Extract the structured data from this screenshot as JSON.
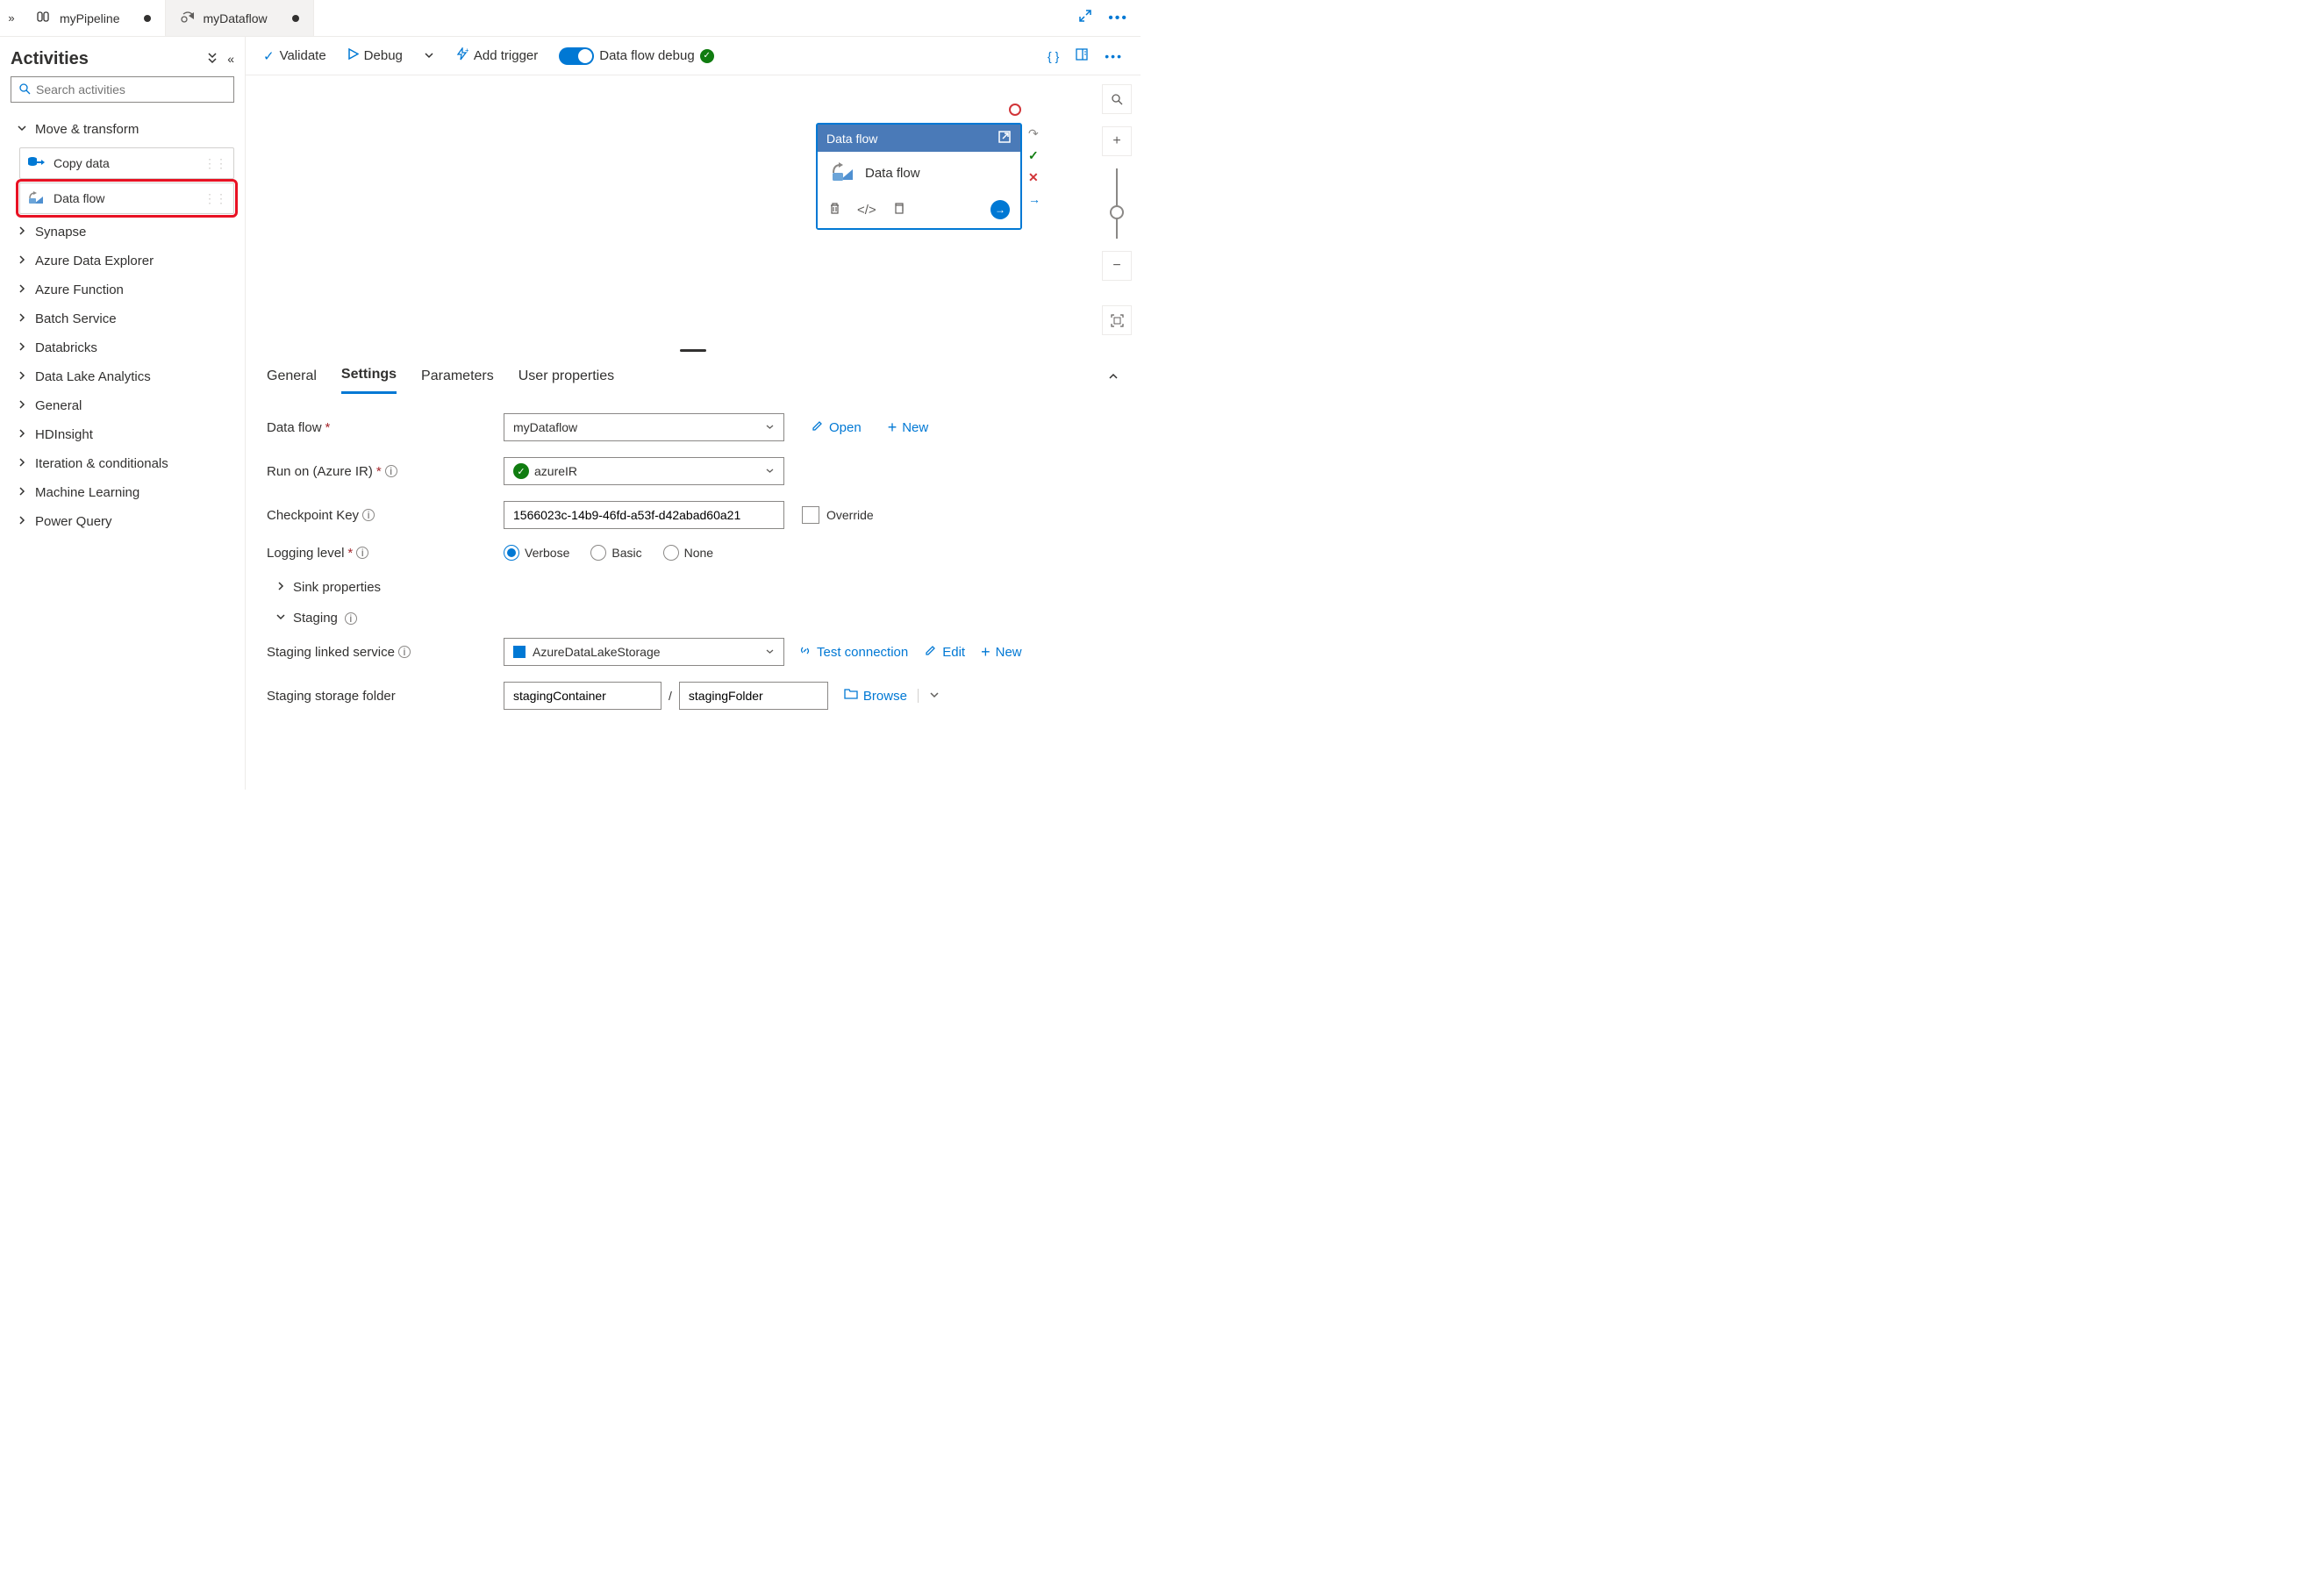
{
  "tabs": {
    "pipeline": "myPipeline",
    "dataflow": "myDataflow"
  },
  "sidebar": {
    "title": "Activities",
    "search_placeholder": "Search activities",
    "move_transform": "Move & transform",
    "copy_data": "Copy data",
    "data_flow": "Data flow",
    "categories": {
      "synapse": "Synapse",
      "ade": "Azure Data Explorer",
      "func": "Azure Function",
      "batch": "Batch Service",
      "databricks": "Databricks",
      "dla": "Data Lake Analytics",
      "general": "General",
      "hdinsight": "HDInsight",
      "iteration": "Iteration & conditionals",
      "ml": "Machine Learning",
      "pq": "Power Query"
    }
  },
  "toolbar": {
    "validate": "Validate",
    "debug": "Debug",
    "add_trigger": "Add trigger",
    "dataflow_debug": "Data flow debug"
  },
  "canvas_node": {
    "header": "Data flow",
    "body": "Data flow"
  },
  "panel_tabs": {
    "general": "General",
    "settings": "Settings",
    "parameters": "Parameters",
    "user_properties": "User properties"
  },
  "settings": {
    "data_flow_label": "Data flow",
    "data_flow_value": "myDataflow",
    "open": "Open",
    "new": "New",
    "run_on_label": "Run on (Azure IR)",
    "run_on_value": "azureIR",
    "checkpoint_label": "Checkpoint Key",
    "checkpoint_value": "1566023c-14b9-46fd-a53f-d42abad60a21",
    "override": "Override",
    "logging_label": "Logging level",
    "log_verbose": "Verbose",
    "log_basic": "Basic",
    "log_none": "None",
    "sink_properties": "Sink properties",
    "staging": "Staging",
    "staging_linked_label": "Staging linked service",
    "staging_linked_value": "AzureDataLakeStorage",
    "test_connection": "Test connection",
    "edit": "Edit",
    "staging_folder_label": "Staging storage folder",
    "staging_container": "stagingContainer",
    "staging_folder": "stagingFolder",
    "browse": "Browse"
  }
}
